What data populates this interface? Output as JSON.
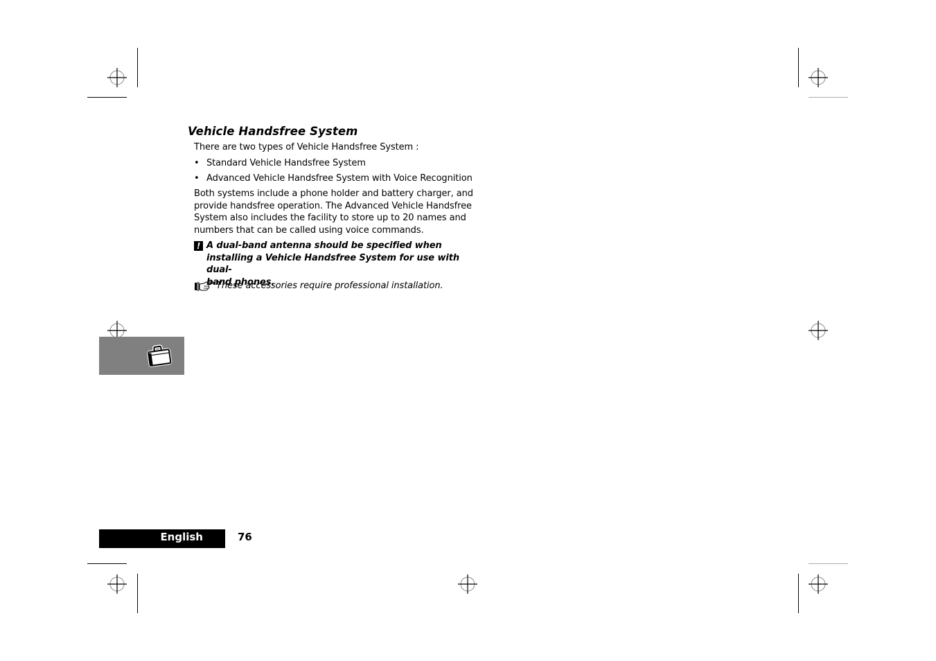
{
  "section": {
    "title": "Vehicle Handsfree System",
    "intro": "There are two types of Vehicle Handsfree System :",
    "bullets": [
      "Standard Vehicle Handsfree System",
      "Advanced Vehicle Handsfree System with Voice Recognition"
    ],
    "paragraph_lines": [
      "Both systems include a phone holder and battery charger, and",
      "provide handsfree operation. The Advanced Vehicle Handsfree",
      "System also includes the facility to store up to 20 names and",
      "numbers that can be called using voice commands."
    ],
    "warning": {
      "icon": "exclamation-icon",
      "icon_glyph": "!",
      "lines": [
        "A dual-band antenna should be specified when",
        "installing a Vehicle Handsfree System for use with dual-",
        "band phones."
      ]
    },
    "note": {
      "icon": "pointing-hand-icon",
      "text": "These accessories require professional installation."
    }
  },
  "side_tab": {
    "icon": "briefcase-icon",
    "color": "#808080"
  },
  "footer": {
    "language": "English",
    "page_number": "76"
  },
  "print_marks": {
    "registration_mark_icon": "crosshair-icon"
  }
}
